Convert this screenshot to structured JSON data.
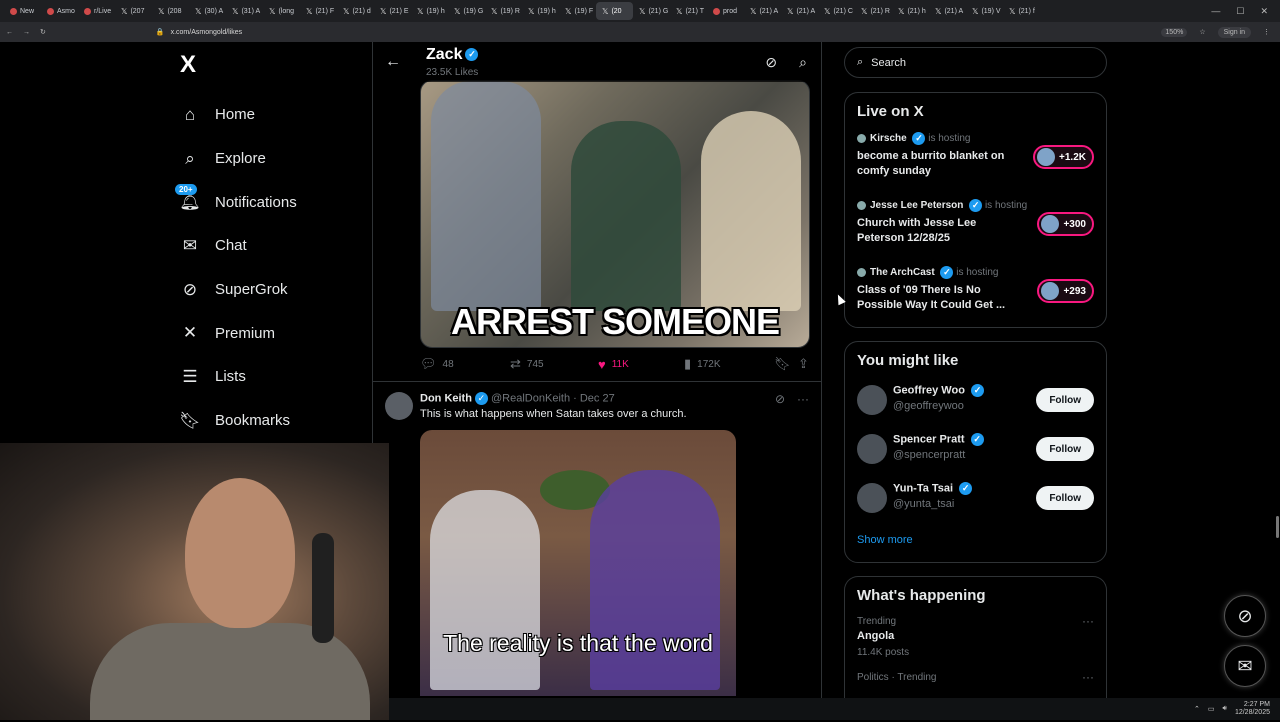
{
  "browser": {
    "tabs": [
      "New",
      "Asmo",
      "r/Live",
      "(207",
      "(208",
      "(30) A",
      "(31) A",
      "(long",
      "(21) F",
      "(21) d",
      "(21) E",
      "(19) h",
      "(19) G",
      "(19) R",
      "(19) h",
      "(19) F",
      "(20",
      "(21) G",
      "(21) T",
      "prod",
      "(21) A",
      "(21) A",
      "(21) C",
      "(21) R",
      "(21) h",
      "(21) A",
      "(19) V",
      "(21) f"
    ],
    "active_tab_index": 16,
    "url": "x.com/Asmongold/likes",
    "zoom": "150%",
    "signin": "Sign in"
  },
  "nav": {
    "logo": "X",
    "items": [
      {
        "label": "Home",
        "icon": "home-icon"
      },
      {
        "label": "Explore",
        "icon": "search-icon"
      },
      {
        "label": "Notifications",
        "icon": "bell-icon",
        "badge": "20+"
      },
      {
        "label": "Chat",
        "icon": "mail-icon"
      },
      {
        "label": "SuperGrok",
        "icon": "grok-icon"
      },
      {
        "label": "Premium",
        "icon": "x-icon"
      },
      {
        "label": "Lists",
        "icon": "list-icon"
      },
      {
        "label": "Bookmarks",
        "icon": "bookmark-icon"
      }
    ]
  },
  "header": {
    "name": "Zack",
    "subtitle": "23.5K Likes"
  },
  "tweet1": {
    "image_caption": "ARREST SOMEONE",
    "replies": "48",
    "reposts": "745",
    "likes": "11K",
    "views": "172K"
  },
  "tweet2": {
    "name": "Don Keith",
    "handle": "@RealDonKeith",
    "date": "Dec 27",
    "text": "This is what happens when Satan takes over a church.",
    "image_caption": "The reality is that the word"
  },
  "search": {
    "placeholder": "Search"
  },
  "live": {
    "title": "Live on X",
    "items": [
      {
        "host": "Kirsche",
        "status": "is hosting",
        "title": "become a burrito blanket on comfy sunday",
        "count": "+1.2K"
      },
      {
        "host": "Jesse Lee Peterson",
        "status": "is hosting",
        "title": "Church with Jesse Lee Peterson 12/28/25",
        "count": "+300"
      },
      {
        "host": "The ArchCast",
        "status": "is hosting",
        "title": "Class of '09 There Is No Possible Way It Could Get ...",
        "count": "+293"
      }
    ]
  },
  "suggestions": {
    "title": "You might like",
    "items": [
      {
        "name": "Geoffrey Woo",
        "handle": "@geoffreywoo",
        "button": "Follow"
      },
      {
        "name": "Spencer Pratt",
        "handle": "@spencerpratt",
        "button": "Follow"
      },
      {
        "name": "Yun-Ta Tsai",
        "handle": "@yunta_tsai",
        "button": "Follow"
      }
    ],
    "show_more": "Show more"
  },
  "happening": {
    "title": "What's happening",
    "items": [
      {
        "category": "Trending",
        "name": "Angola",
        "posts": "11.4K posts"
      },
      {
        "category": "Politics · Trending",
        "name": "",
        "posts": ""
      }
    ]
  },
  "taskbar": {
    "time": "2:27 PM",
    "date": "12/28/2025"
  },
  "colors": {
    "accent": "#1d9bf0",
    "like": "#f91880",
    "background": "#000000"
  }
}
